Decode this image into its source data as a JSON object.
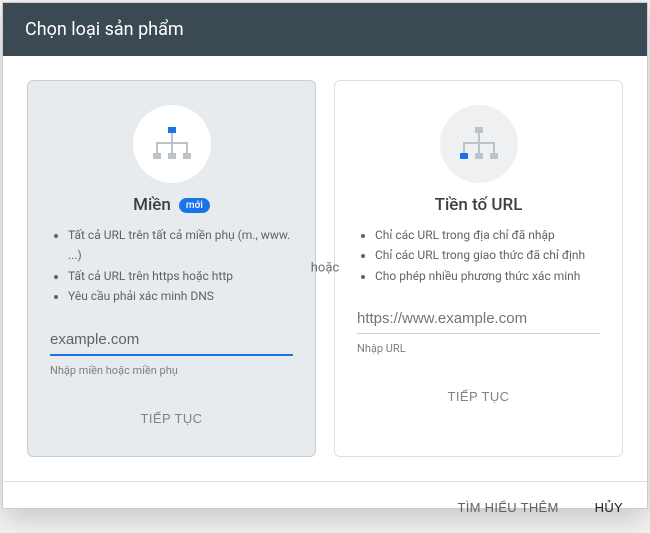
{
  "header": {
    "title": "Chọn loại sản phẩm"
  },
  "or_label": "hoặc",
  "card_domain": {
    "icon": "sitemap-icon-blue",
    "title": "Miền",
    "badge": "mới",
    "bullets": [
      "Tất cả URL trên tất cả miền phụ (m., www. ...)",
      "Tất cả URL trên https hoặc http",
      "Yêu cầu phải xác minh DNS"
    ],
    "input_value": "example.com",
    "input_placeholder": "example.com",
    "helper": "Nhập miền hoặc miền phụ",
    "continue_label": "TIẾP TỤC"
  },
  "card_prefix": {
    "icon": "sitemap-icon-grey",
    "title": "Tiền tố URL",
    "bullets": [
      "Chỉ các URL trong địa chỉ đã nhập",
      "Chỉ các URL trong giao thức đã chỉ định",
      "Cho phép nhiều phương thức xác minh"
    ],
    "input_value": "",
    "input_placeholder": "https://www.example.com",
    "helper": "Nhập URL",
    "continue_label": "TIẾP TỤC"
  },
  "footer": {
    "learn_more": "TÌM HIỂU THÊM",
    "cancel": "HỦY"
  },
  "colors": {
    "accent": "#1a73e8",
    "header_bg": "#3b4a52"
  }
}
